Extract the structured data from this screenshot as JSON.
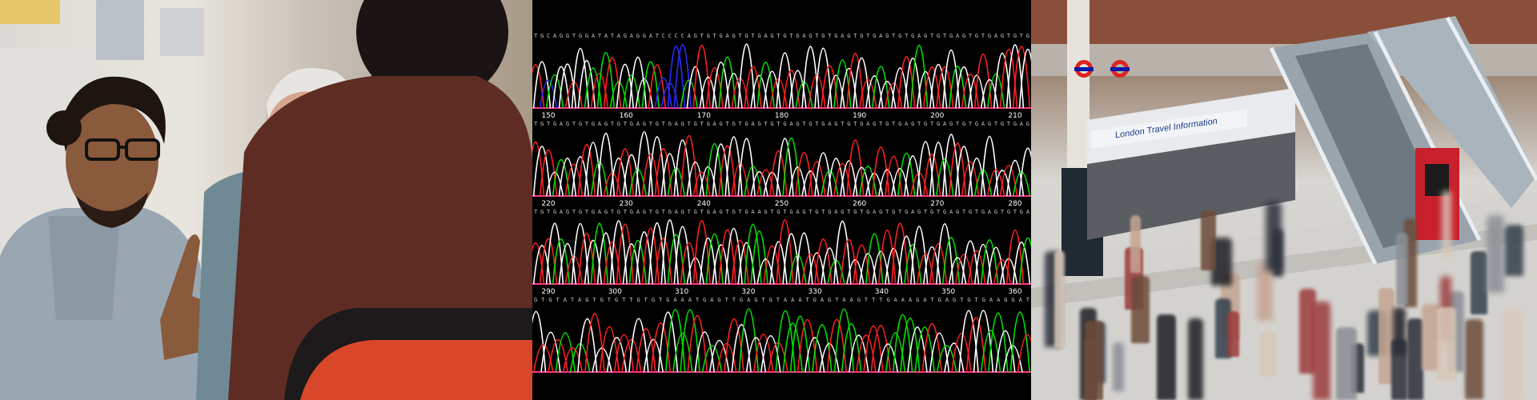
{
  "panels": [
    {
      "id": "left",
      "description_none": true
    },
    {
      "id": "middle"
    },
    {
      "id": "right"
    }
  ],
  "chromatogram": {
    "colors": {
      "A": "#00e000",
      "C": "#2a2aff",
      "G": "#ffffff",
      "T": "#ff2020",
      "baseline": "#ff3a8c"
    },
    "rows": [
      {
        "sequence": "TGCAGGTGGATATAGAGGATCCCCAGTGTGAGTGTGAGTGTGAGTGTGAGTGTGAGTGTGAGTGTGAGTGTGAGTGTG",
        "positions": [
          "150",
          "160",
          "170",
          "180",
          "190",
          "200",
          "210"
        ]
      },
      {
        "sequence": "TGTGAGTGTGAGTGTGAGTGTGAGTGTGAGTGTGAGTGTGAGTGTGAGTGTGAGTGTGAGTGTGAGTGTGAGTGTGAG",
        "positions": [
          "220",
          "230",
          "240",
          "250",
          "260",
          "270",
          "280"
        ]
      },
      {
        "sequence": "TGTGAGTGTGAGTGTGAGTGTGAGTGTGAGTGTGAAGTGTGAGTGTGAGTGTGAGTGTGAGTGTGAGTGTGAGTGTGA",
        "positions": [
          "290",
          "300",
          "310",
          "320",
          "330",
          "340",
          "350",
          "360"
        ]
      },
      {
        "sequence": "GTGTATAGTGTGTTGTGTGAAATGAGTTGAGTGTAAATGAGTAAGTTTGAAAGATGAGTGTGAAGGAT",
        "positions": []
      }
    ]
  },
  "station": {
    "travel_info_sign": "London Travel Information"
  }
}
